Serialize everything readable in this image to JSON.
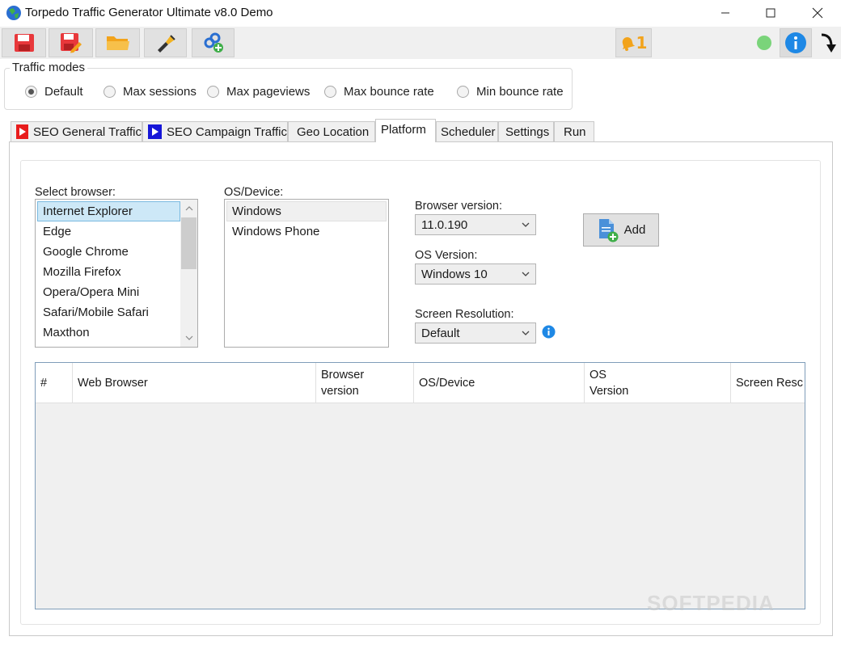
{
  "window": {
    "title": "Torpedo Traffic Generator Ultimate v8.0 Demo",
    "controls": [
      "minimize",
      "maximize",
      "close"
    ]
  },
  "toolbar": {
    "icons": [
      "save-icon",
      "save-as-icon",
      "open-folder-icon",
      "flashlight-icon",
      "link-add-icon"
    ],
    "notifications_count": "1",
    "status_color": "#7ad47a",
    "info_color": "#1e88e5"
  },
  "traffic_modes": {
    "title": "Traffic modes",
    "options": [
      "Default",
      "Max sessions",
      "Max pageviews",
      "Max bounce rate",
      "Min bounce rate"
    ],
    "selected": "Default"
  },
  "tabs": [
    "SEO General Traffic",
    "SEO Campaign Traffic",
    "Geo Location",
    "Platform",
    "Scheduler",
    "Settings",
    "Run"
  ],
  "active_tab": "Platform",
  "platform": {
    "browser_label": "Select browser:",
    "browsers": [
      "Internet Explorer",
      "Edge",
      "Google Chrome",
      "Mozilla Firefox",
      "Opera/Opera Mini",
      "Safari/Mobile Safari",
      "Maxthon"
    ],
    "selected_browser": "Internet Explorer",
    "os_label": "OS/Device:",
    "os_devices": [
      "Windows",
      "Windows Phone"
    ],
    "selected_os": "Windows",
    "browser_version_label": "Browser version:",
    "browser_version": "11.0.190",
    "os_version_label": "OS Version:",
    "os_version": "Windows 10",
    "screen_res_label": "Screen Resolution:",
    "screen_res": "Default",
    "add_label": "Add"
  },
  "grid": {
    "columns": [
      "#",
      "Web Browser",
      "Browser version",
      "OS/Device",
      "OS Version",
      "Screen Resc"
    ],
    "rows": []
  },
  "watermark": "SOFTPEDIA"
}
